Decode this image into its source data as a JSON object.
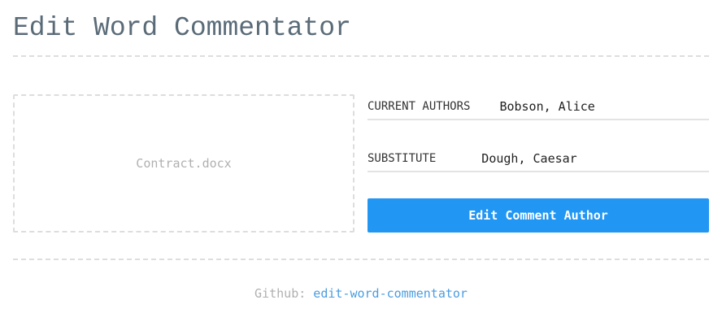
{
  "header": {
    "title": "Edit Word Commentator"
  },
  "dropzone": {
    "filename": "Contract.docx"
  },
  "form": {
    "current_authors_label": "CURRENT AUTHORS",
    "current_authors_value": "Bobson, Alice",
    "substitute_label": "SUBSTITUTE",
    "substitute_value": "Dough, Caesar",
    "submit_label": "Edit Comment Author"
  },
  "footer": {
    "label": "Github:",
    "link_text": "edit-word-commentator"
  },
  "colors": {
    "title": "#5a6b78",
    "accent": "#2196f3",
    "link": "#4a9de0",
    "muted": "#b0b0b0",
    "divider": "#dddddd"
  }
}
